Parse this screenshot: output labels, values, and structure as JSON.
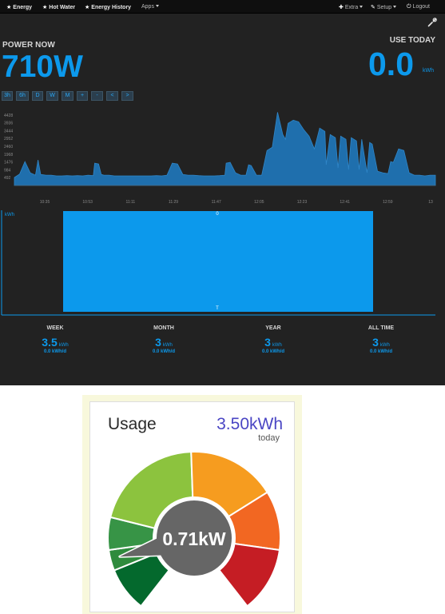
{
  "nav": {
    "energy": "Energy",
    "hot_water": "Hot Water",
    "energy_history": "Energy History",
    "apps": "Apps",
    "extra": "Extra",
    "setup": "Setup",
    "logout": "Logout"
  },
  "power_now": {
    "label": "POWER NOW",
    "value": "710W"
  },
  "use_today": {
    "label": "USE TODAY",
    "value": "0.0",
    "unit": "kWh"
  },
  "range_buttons": [
    "3h",
    "6h",
    "D",
    "W",
    "M",
    "+",
    "-",
    "<",
    ">"
  ],
  "chart_data": [
    {
      "type": "area",
      "y_ticks": [
        "4428",
        "3936",
        "3444",
        "2952",
        "2460",
        "1968",
        "1476",
        "984",
        "492"
      ],
      "x_ticks": [
        "10:35",
        "10:53",
        "11:11",
        "11:29",
        "11:47",
        "12:05",
        "12:23",
        "12:41",
        "12:59",
        "13"
      ],
      "ylim": [
        0,
        4920
      ],
      "x": [
        0,
        2,
        4,
        6,
        8,
        9,
        10,
        12,
        14,
        16,
        18,
        20,
        22,
        24,
        26,
        28,
        30,
        30.5,
        32,
        33,
        34,
        36,
        38,
        40,
        42,
        44,
        46,
        48,
        50,
        52,
        54,
        56,
        58,
        60,
        62,
        64,
        66,
        68,
        70,
        72,
        74,
        76,
        78,
        80,
        80.5,
        82,
        84,
        86,
        88,
        89,
        90,
        92,
        94,
        96,
        98,
        100,
        102,
        103,
        104,
        106,
        108,
        110,
        112,
        114,
        116,
        118,
        118.5,
        120,
        122,
        123,
        124,
        126,
        127,
        128,
        130,
        131,
        132,
        134,
        135,
        136,
        138,
        140,
        142,
        143,
        144,
        146,
        148,
        150,
        152,
        154,
        156,
        158,
        160
      ],
      "values": [
        500,
        720,
        1500,
        800,
        650,
        1600,
        700,
        650,
        650,
        600,
        600,
        620,
        600,
        620,
        600,
        650,
        620,
        1400,
        1350,
        700,
        650,
        650,
        600,
        600,
        600,
        600,
        600,
        600,
        600,
        600,
        620,
        600,
        650,
        1400,
        1350,
        700,
        650,
        650,
        620,
        600,
        600,
        600,
        620,
        650,
        1400,
        1450,
        800,
        650,
        650,
        1300,
        1250,
        650,
        650,
        2200,
        2400,
        4600,
        3200,
        2900,
        3900,
        4100,
        4000,
        3500,
        3100,
        2300,
        3600,
        3400,
        1300,
        3200,
        3000,
        1100,
        3100,
        2900,
        1000,
        3000,
        2800,
        1000,
        2900,
        800,
        2700,
        2600,
        900,
        800,
        750,
        1500,
        1450,
        2300,
        2200,
        800,
        650,
        650,
        600,
        650,
        650,
        600,
        600,
        620
      ]
    },
    {
      "type": "bar",
      "ylabel": "kWh",
      "top_label": "0",
      "bottom_label": "T",
      "values": [
        0
      ]
    },
    {
      "type": "pie",
      "title": "Usage",
      "value": 0.71,
      "value_label": "0.71kW",
      "segment_colors": [
        "#04692d",
        "#2f8b3d",
        "#379446",
        "#8cc33e",
        "#f69c1f",
        "#f26722",
        "#c51d24"
      ]
    }
  ],
  "stats": [
    {
      "label": "WEEK",
      "value": "3.5",
      "unit": "kWh",
      "daily": "0.0 kWh/d"
    },
    {
      "label": "MONTH",
      "value": "3",
      "unit": "kWh",
      "daily": "0.0 kWh/d"
    },
    {
      "label": "YEAR",
      "value": "3",
      "unit": "kWh",
      "daily": "0.0 kWh/d"
    },
    {
      "label": "ALL TIME",
      "value": "3",
      "unit": "kWh",
      "daily": "0.0 kWh/d"
    }
  ],
  "usage": {
    "title": "Usage",
    "value": "3.50kWh",
    "period": "today",
    "power": "0.71kW"
  },
  "colors": {
    "accent": "#0c99ec",
    "background": "#222222",
    "chart_fill": "#1f6fad",
    "bar_fill": "#0c99ec"
  }
}
